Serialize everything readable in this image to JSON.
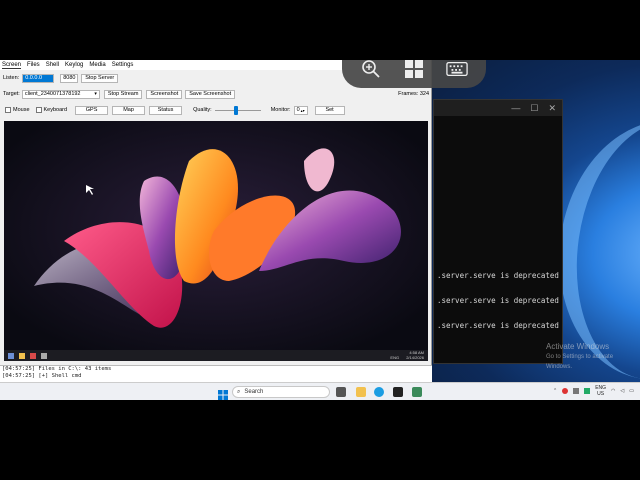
{
  "app": {
    "menu": [
      "Screen",
      "Files",
      "Shell",
      "Keylog",
      "Media",
      "Settings"
    ],
    "listen_label": "Listen:",
    "listen_ip": "0.0.0.0",
    "listen_port": "8080",
    "stop_server": "Stop Server",
    "target_label": "Target:",
    "target_value": "client_2340071378192",
    "stop_stream": "Stop Stream",
    "screenshot": "Screenshot",
    "save_screenshot": "Save Screenshot",
    "frames_label": "Frames: 324",
    "mouse_label": "Mouse",
    "keyboard_label": "Keyboard",
    "gps": "GPS",
    "map": "Map",
    "status": "Status",
    "quality_label": "Quality:",
    "quality_level": 0.45,
    "monitor_label": "Monitor:",
    "monitor_value": "0",
    "set": "Set",
    "log_lines": [
      "[04:57:25] Files in C:\\: 43 items",
      "[04:57:25] [+] Shell cmd"
    ]
  },
  "remote": {
    "tray_time": "4:58 AM",
    "tray_date": "2/14/2026",
    "tray_lang": "ENG"
  },
  "terminal": {
    "lines": [
      ".server.serve is deprecated",
      ".server.serve is deprecated",
      ".server.serve is deprecated"
    ]
  },
  "desktop": {
    "activate_title": "Activate Windows",
    "activate_sub": "Go to Settings to activate Windows."
  },
  "taskbar": {
    "search_placeholder": "Search",
    "lang_top": "ENG",
    "lang_bottom": "US"
  },
  "overlay": {
    "icons": [
      "zoom-in-icon",
      "windows-icon",
      "keyboard-icon"
    ]
  },
  "colors": {
    "accent": "#0078d4",
    "terminal_bg": "#0c0c0c",
    "overlay_bg": "#464646"
  }
}
